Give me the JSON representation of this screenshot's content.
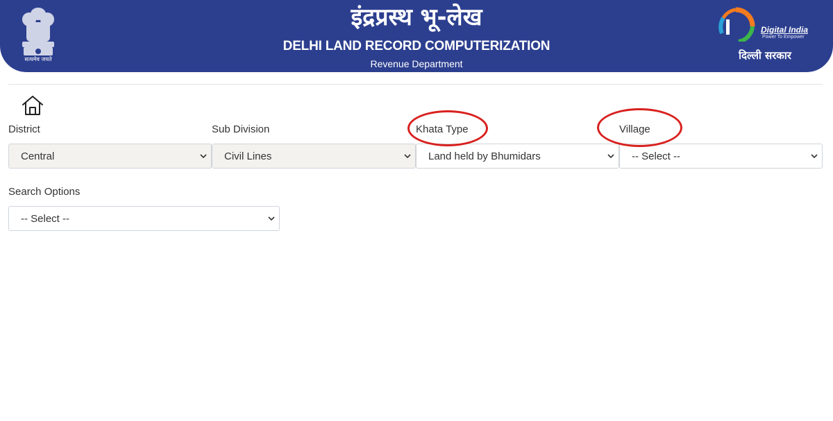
{
  "header": {
    "title_hindi": "इंद्रप्रस्थ भू-लेख",
    "title_en": "DELHI LAND RECORD COMPUTERIZATION",
    "department": "Revenue Department",
    "emblem_motto": "सत्यमेव जयते",
    "digital_india": "Digital India",
    "digital_india_tagline": "Power To Empower",
    "delhi_govt": "दिल्ली सरकार"
  },
  "form": {
    "district": {
      "label": "District",
      "value": "Central"
    },
    "sub_division": {
      "label": "Sub Division",
      "value": "Civil Lines"
    },
    "khata_type": {
      "label": "Khata Type",
      "value": "Land held by Bhumidars"
    },
    "village": {
      "label": "Village",
      "value": "-- Select --"
    },
    "search_options": {
      "label": "Search Options",
      "value": "-- Select --"
    }
  },
  "colors": {
    "header_bg": "#2c3f8f",
    "annotation": "#d8211e"
  }
}
